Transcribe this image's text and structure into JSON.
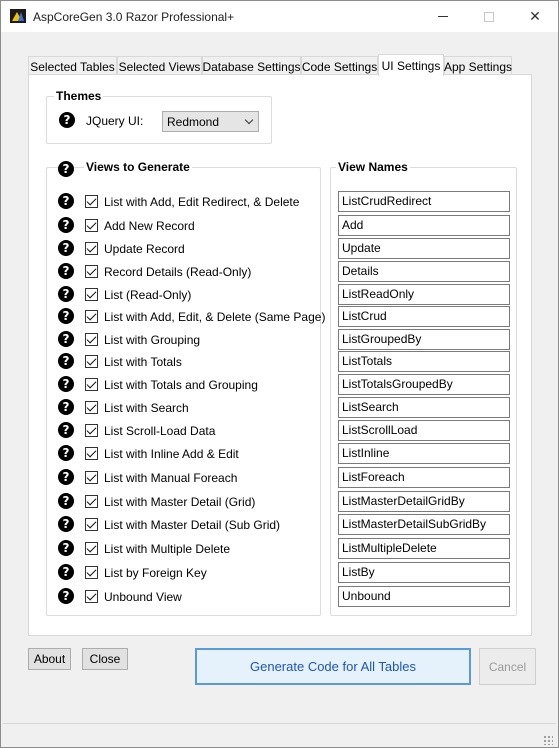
{
  "window": {
    "title": "AspCoreGen 3.0 Razor Professional+",
    "close_glyph": "✕",
    "help_glyph": "?"
  },
  "tabs": [
    {
      "label": "Selected Tables"
    },
    {
      "label": "Selected Views"
    },
    {
      "label": "Database Settings"
    },
    {
      "label": "Code Settings"
    },
    {
      "label": "UI Settings",
      "active": true
    },
    {
      "label": "App Settings"
    }
  ],
  "themes": {
    "legend": "Themes",
    "label": "JQuery UI:",
    "selected": "Redmond"
  },
  "views": {
    "legend": "Views to Generate",
    "names_legend": "View Names",
    "items": [
      {
        "label": "List with Add, Edit Redirect, & Delete",
        "name": "ListCrudRedirect",
        "checked": true
      },
      {
        "label": "Add New Record",
        "name": "Add",
        "checked": true
      },
      {
        "label": "Update Record",
        "name": "Update",
        "checked": true
      },
      {
        "label": "Record Details (Read-Only)",
        "name": "Details",
        "checked": true
      },
      {
        "label": "List (Read-Only)",
        "name": "ListReadOnly",
        "checked": true
      },
      {
        "label": "List with Add, Edit, & Delete (Same Page)",
        "name": "ListCrud",
        "checked": true
      },
      {
        "label": "List with Grouping",
        "name": "ListGroupedBy",
        "checked": true
      },
      {
        "label": "List with Totals",
        "name": "ListTotals",
        "checked": true
      },
      {
        "label": "List with Totals and Grouping",
        "name": "ListTotalsGroupedBy",
        "checked": true
      },
      {
        "label": "List with Search",
        "name": "ListSearch",
        "checked": true
      },
      {
        "label": "List Scroll-Load Data",
        "name": "ListScrollLoad",
        "checked": true
      },
      {
        "label": "List with Inline Add & Edit",
        "name": "ListInline",
        "checked": true
      },
      {
        "label": "List with Manual Foreach",
        "name": "ListForeach",
        "checked": true
      },
      {
        "label": "List with Master Detail (Grid)",
        "name": "ListMasterDetailGridBy",
        "checked": true
      },
      {
        "label": "List with Master Detail (Sub Grid)",
        "name": "ListMasterDetailSubGridBy",
        "checked": true
      },
      {
        "label": "List with Multiple Delete",
        "name": "ListMultipleDelete",
        "checked": true
      },
      {
        "label": "List by Foreign Key",
        "name": "ListBy",
        "checked": true
      },
      {
        "label": "Unbound View",
        "name": "Unbound",
        "checked": true
      }
    ]
  },
  "buttons": {
    "about": "About",
    "close": "Close",
    "generate": "Generate Code for All Tables",
    "cancel": "Cancel"
  },
  "colors": {
    "primary_button_text": "#1e56b7",
    "primary_button_border": "#5a9ad6"
  }
}
